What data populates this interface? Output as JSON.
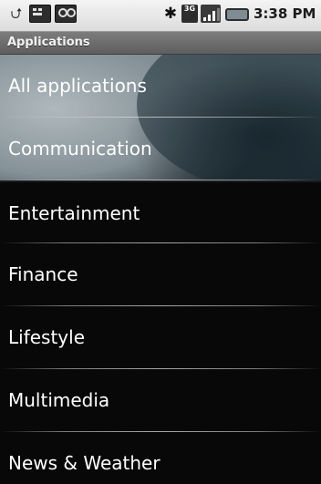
{
  "status_bar": {
    "time": "3:38 PM",
    "notifications": [
      "usb-icon",
      "keyboard-icon",
      "voicemail-icon"
    ],
    "indicators": [
      "bluetooth-icon",
      "3g-icon",
      "signal-icon",
      "battery-icon"
    ],
    "network_badge": "3G"
  },
  "title_bar": {
    "title": "Applications"
  },
  "list": {
    "items": [
      {
        "label": "All applications"
      },
      {
        "label": "Communication"
      },
      {
        "label": "Entertainment"
      },
      {
        "label": "Finance"
      },
      {
        "label": "Lifestyle"
      },
      {
        "label": "Multimedia"
      },
      {
        "label": "News & Weather"
      }
    ]
  },
  "colors": {
    "list_text": "#ffffff",
    "title_bar": "#6e6e6e",
    "status_bar": "#e6e6e6"
  }
}
